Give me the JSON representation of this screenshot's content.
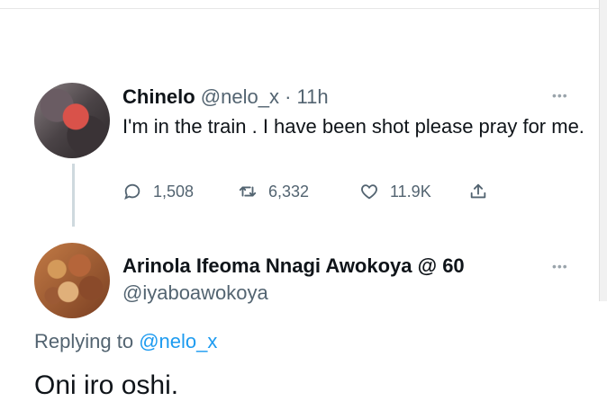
{
  "tweet1": {
    "name": "Chinelo",
    "handle": "@nelo_x",
    "separator": " · ",
    "time": "11h",
    "text": "I'm in the train .  I have been shot please pray for me.",
    "more": "•••",
    "actions": {
      "replies": "1,508",
      "retweets": "6,332",
      "likes": "11.9K"
    }
  },
  "tweet2": {
    "name": "Arinola Ifeoma Nnagi Awokoya @ 60",
    "handle": "@iyaboawokoya",
    "more": "•••",
    "replying_prefix": "Replying to ",
    "replying_to": "@nelo_x",
    "text": "Oni iro oshi."
  },
  "colors": {
    "text": "#0f1419",
    "secondary": "#536471",
    "link": "#1d9bf0",
    "thread_line": "#cfd9de"
  },
  "icons": [
    "reply-icon",
    "retweet-icon",
    "like-icon",
    "share-icon",
    "more-icon"
  ]
}
